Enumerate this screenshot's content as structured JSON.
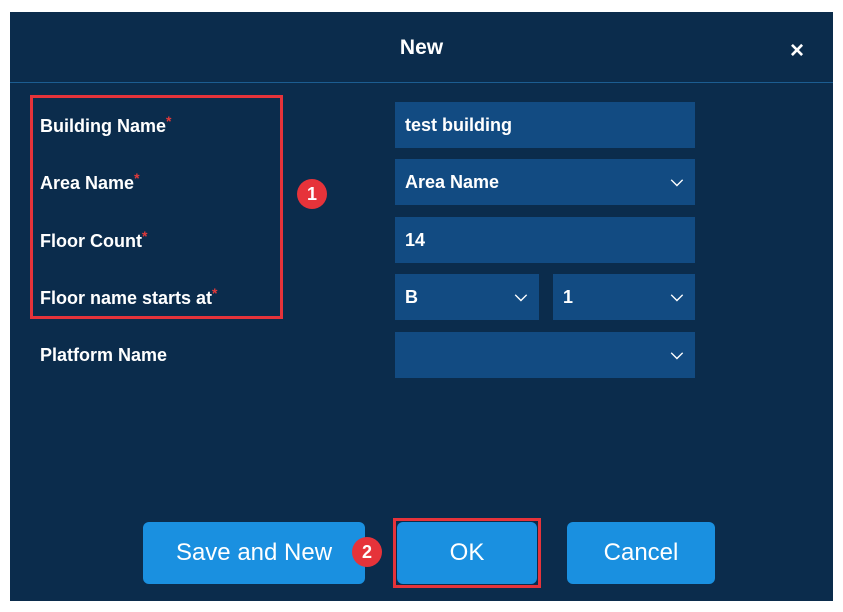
{
  "dialog": {
    "title": "New",
    "close_icon": "close-icon",
    "close_glyph": "×"
  },
  "form": {
    "required_mark": "*",
    "building_name": {
      "label": "Building Name",
      "value": "test building"
    },
    "area_name": {
      "label": "Area Name",
      "value": "Area Name"
    },
    "floor_count": {
      "label": "Floor Count",
      "value": "14"
    },
    "floor_start": {
      "label": "Floor name starts at",
      "prefix_value": "B",
      "number_value": "1"
    },
    "platform_name": {
      "label": "Platform Name",
      "value": ""
    }
  },
  "annotations": {
    "marker_1": "1",
    "marker_2": "2"
  },
  "buttons": {
    "save_and_new": "Save and New",
    "ok": "OK",
    "cancel": "Cancel"
  },
  "icons": {
    "chevron_glyph": "⌵"
  },
  "colors": {
    "dialog_bg": "#0b2c4c",
    "field_bg": "#124b82",
    "button_bg": "#1a90e0",
    "highlight": "#e6333a",
    "required": "#e23a3a"
  }
}
